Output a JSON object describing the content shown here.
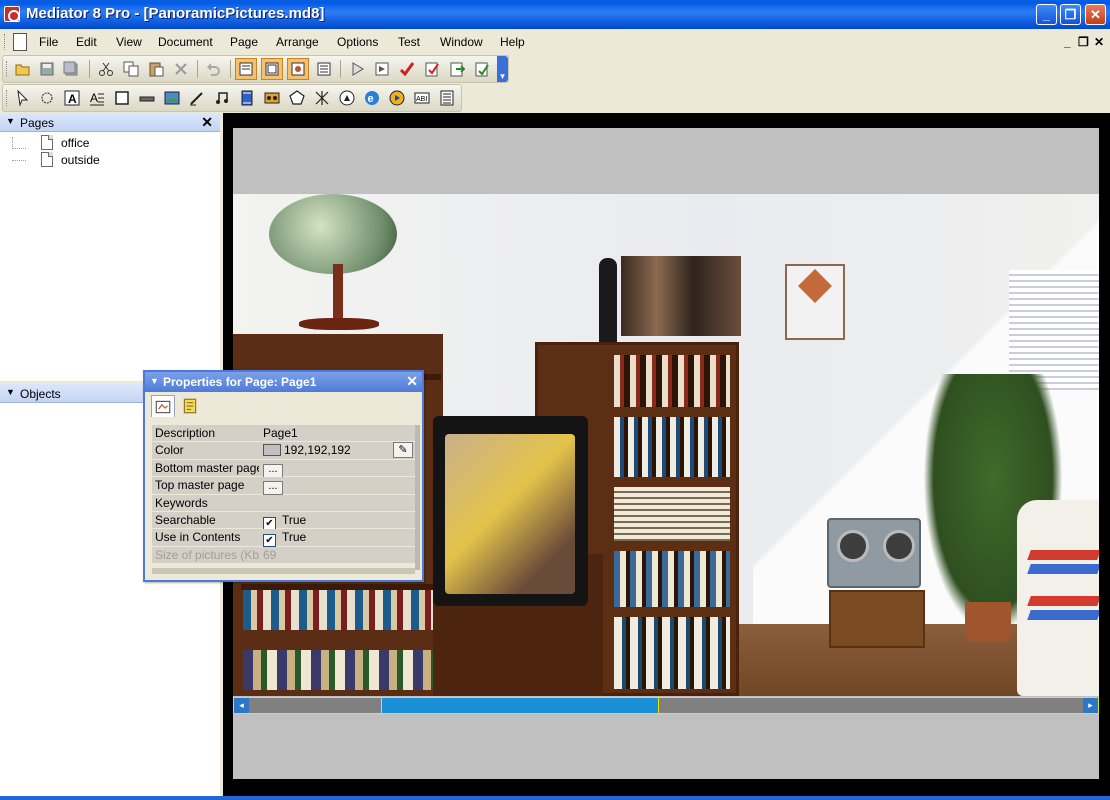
{
  "window": {
    "title": "Mediator 8 Pro - [PanoramicPictures.md8]",
    "minimize": "_",
    "maximize": "❐",
    "close": "✕"
  },
  "menu": {
    "items": [
      "File",
      "Edit",
      "View",
      "Document",
      "Page",
      "Arrange",
      "Options",
      "Test",
      "Window",
      "Help"
    ],
    "mdi_min": "_",
    "mdi_restore": "❐",
    "mdi_close": "✕"
  },
  "pages_panel": {
    "title": "Pages",
    "close": "✕",
    "items": [
      "office",
      "outside"
    ]
  },
  "objects_panel": {
    "title": "Objects"
  },
  "properties": {
    "title": "Properties for Page: Page1",
    "close": "✕",
    "rows": [
      {
        "name": "Description",
        "value": "Page1"
      },
      {
        "name": "Color",
        "value": "192,192,192"
      },
      {
        "name": "Bottom master page",
        "value": "..."
      },
      {
        "name": "Top master page",
        "value": "..."
      },
      {
        "name": "Keywords",
        "value": ""
      },
      {
        "name": "Searchable",
        "value": "True",
        "check": "✔"
      },
      {
        "name": "Use in Contents",
        "value": "True",
        "check": "✔"
      },
      {
        "name": "Size of pictures (Kb)",
        "value": "69"
      }
    ]
  },
  "scrollbar": {
    "left_arrow": "◂",
    "right_arrow": "▸"
  },
  "colors": {
    "page_background": "#c0c0c0",
    "titlebar": "#0058e6",
    "scroll_thumb": "#1b8fd6"
  }
}
